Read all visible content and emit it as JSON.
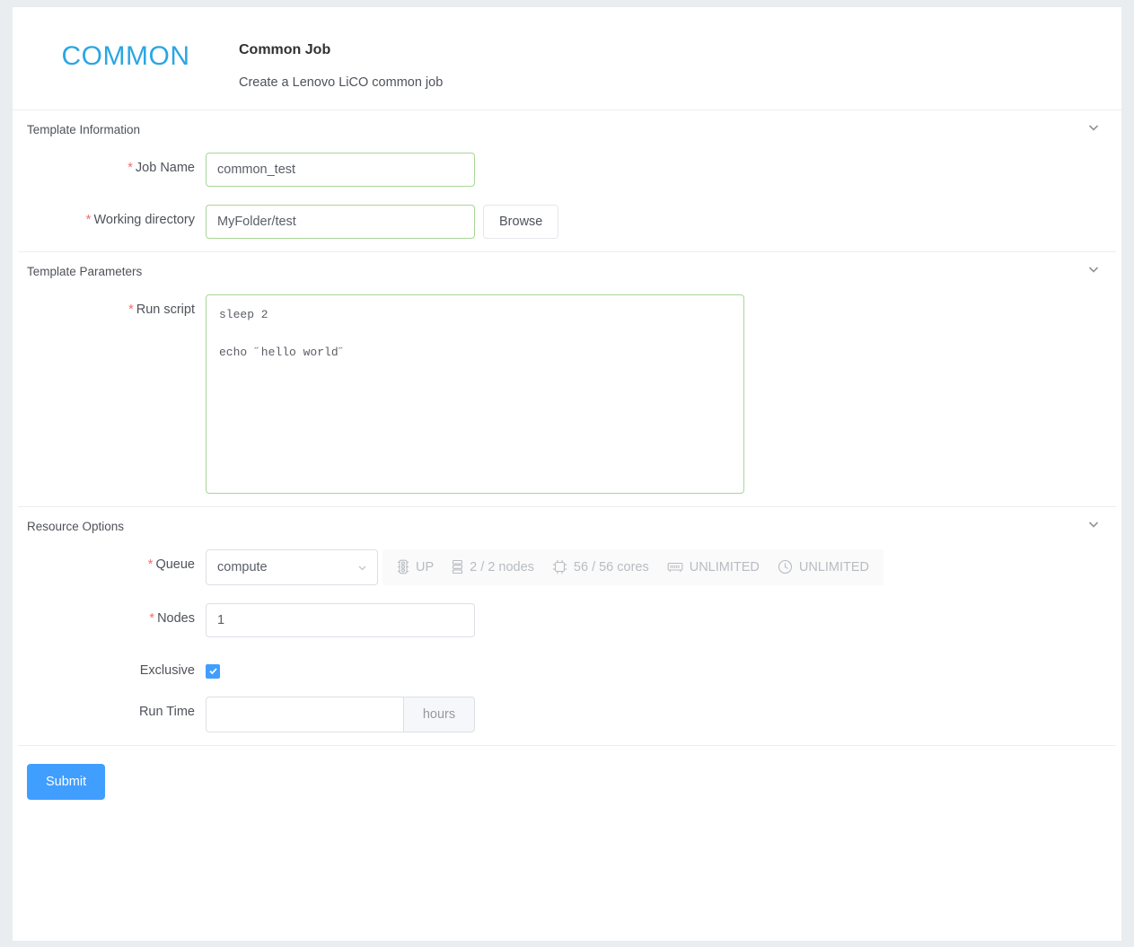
{
  "header": {
    "logo_text": "COMMON",
    "title": "Common Job",
    "subtitle": "Create a Lenovo LiCO common job"
  },
  "sections": {
    "template_information": {
      "heading": "Template Information",
      "collapse_icon": "chevron-down-icon",
      "job_name": {
        "label": "Job Name",
        "required_mark": "*",
        "value": "common_test",
        "placeholder": ""
      },
      "working_directory": {
        "label": "Working directory",
        "required_mark": "*",
        "value": "MyFolder/test",
        "placeholder": "",
        "browse_label": "Browse"
      }
    },
    "template_parameters": {
      "heading": "Template Parameters",
      "collapse_icon": "chevron-down-icon",
      "run_script": {
        "label": "Run script",
        "required_mark": "*",
        "value": "sleep 2\n\necho ˝hello world˝",
        "placeholder": ""
      }
    },
    "resource_options": {
      "heading": "Resource Options",
      "collapse_icon": "chevron-down-icon",
      "queue": {
        "label": "Queue",
        "required_mark": "*",
        "selected": "compute",
        "options": [
          "compute"
        ],
        "badges": [
          {
            "icon": "traffic-light-icon",
            "text": "UP"
          },
          {
            "icon": "nodes-stack-icon",
            "text": "2 / 2 nodes"
          },
          {
            "icon": "cpu-chip-icon",
            "text": "56 / 56 cores"
          },
          {
            "icon": "memory-module-icon",
            "text": "UNLIMITED"
          },
          {
            "icon": "clock-icon",
            "text": "UNLIMITED"
          }
        ]
      },
      "nodes": {
        "label": "Nodes",
        "required_mark": "*",
        "value": "1",
        "placeholder": ""
      },
      "exclusive": {
        "label": "Exclusive",
        "checked": true
      },
      "run_time": {
        "label": "Run Time",
        "value": "",
        "placeholder": "",
        "unit": "hours"
      }
    }
  },
  "footer": {
    "submit_label": "Submit"
  },
  "colors": {
    "brand_blue": "#2ba6e3",
    "primary_blue": "#409eff",
    "valid_green": "#a8d699",
    "required_red": "#f56c6c",
    "page_bg": "#e9edf0"
  }
}
